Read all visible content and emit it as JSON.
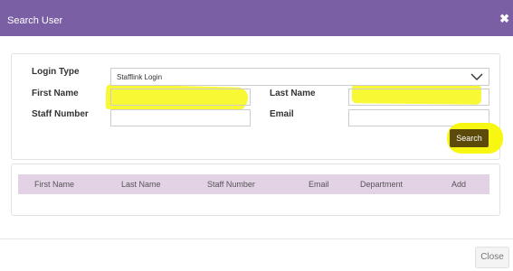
{
  "dialog": {
    "title": "Search User",
    "close_icon": "close-icon"
  },
  "form": {
    "login_type_label": "Login Type",
    "login_type_value": "Stafflink Login",
    "first_name_label": "First Name",
    "first_name_value": "",
    "last_name_label": "Last Name",
    "last_name_value": "",
    "staff_number_label": "Staff Number",
    "staff_number_value": "",
    "email_label": "Email",
    "email_value": "",
    "search_label": "Search"
  },
  "results_table": {
    "columns": [
      "First Name",
      "Last Name",
      "Staff Number",
      "Email",
      "Department",
      "Add"
    ]
  },
  "footer": {
    "close_label": "Close"
  },
  "colors": {
    "header": "#7a5fa5",
    "table_header": "#e3d1e5",
    "highlight": "#f7f711",
    "search_button": "#5c4a0a"
  }
}
